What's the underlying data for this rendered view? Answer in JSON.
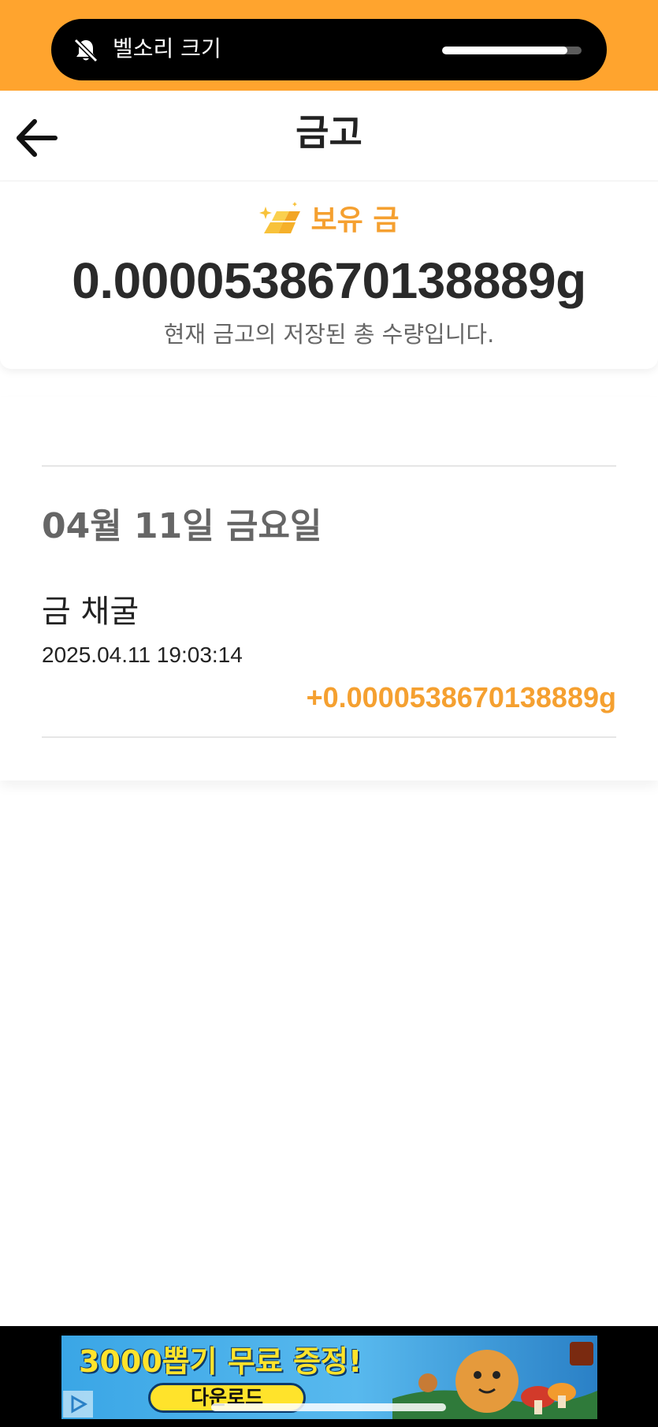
{
  "system": {
    "volume_label": "벨소리 크기",
    "volume_level": 0.9
  },
  "header": {
    "title": "금고"
  },
  "balance": {
    "label": "보유 금",
    "amount": "0.0000538670138889g",
    "description": "현재 금고의 저장된 총 수량입니다."
  },
  "transactions": {
    "date": "04월 11일 금요일",
    "items": [
      {
        "title": "금 채굴",
        "timestamp": "2025.04.11 19:03:14",
        "amount": "+0.0000538670138889g"
      }
    ]
  },
  "ad": {
    "headline": "3000뽑기 무료 증정!",
    "cta": "다운로드"
  },
  "colors": {
    "accent": "#F5A030",
    "status_bar": "#FFA42E",
    "text_dark": "#222222",
    "text_muted": "#666666"
  }
}
